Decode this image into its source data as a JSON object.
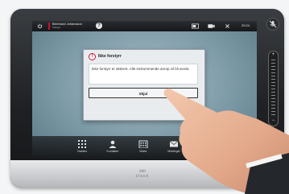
{
  "device": {
    "brand": "cisco"
  },
  "topbar": {
    "user_name": "Bernhard Johansson",
    "user_sub": "Kollega",
    "help": "?",
    "clock": "20:24",
    "icons": [
      "power-icon",
      "help-icon",
      "layout-icon",
      "camera-icon",
      "settings-icon"
    ]
  },
  "dialog": {
    "title": "Ikke forstyrr",
    "body": "Ikke forstyrr er aktivert. Alle innkommende anrop vil bli avvist.",
    "button": "Skjul"
  },
  "nav": [
    {
      "label": "Tastatur",
      "icon": "keypad-icon"
    },
    {
      "label": "Kontakter",
      "icon": "contacts-icon"
    },
    {
      "label": "Møter",
      "icon": "calendar-icon"
    },
    {
      "label": "Meldinger",
      "icon": "messages-icon"
    }
  ],
  "side": {
    "vol_plus": "+",
    "vol_minus": "−"
  },
  "colors": {
    "accent": "#c8102e",
    "screen": "#7d9aa7",
    "bezel": "#1f2124"
  }
}
